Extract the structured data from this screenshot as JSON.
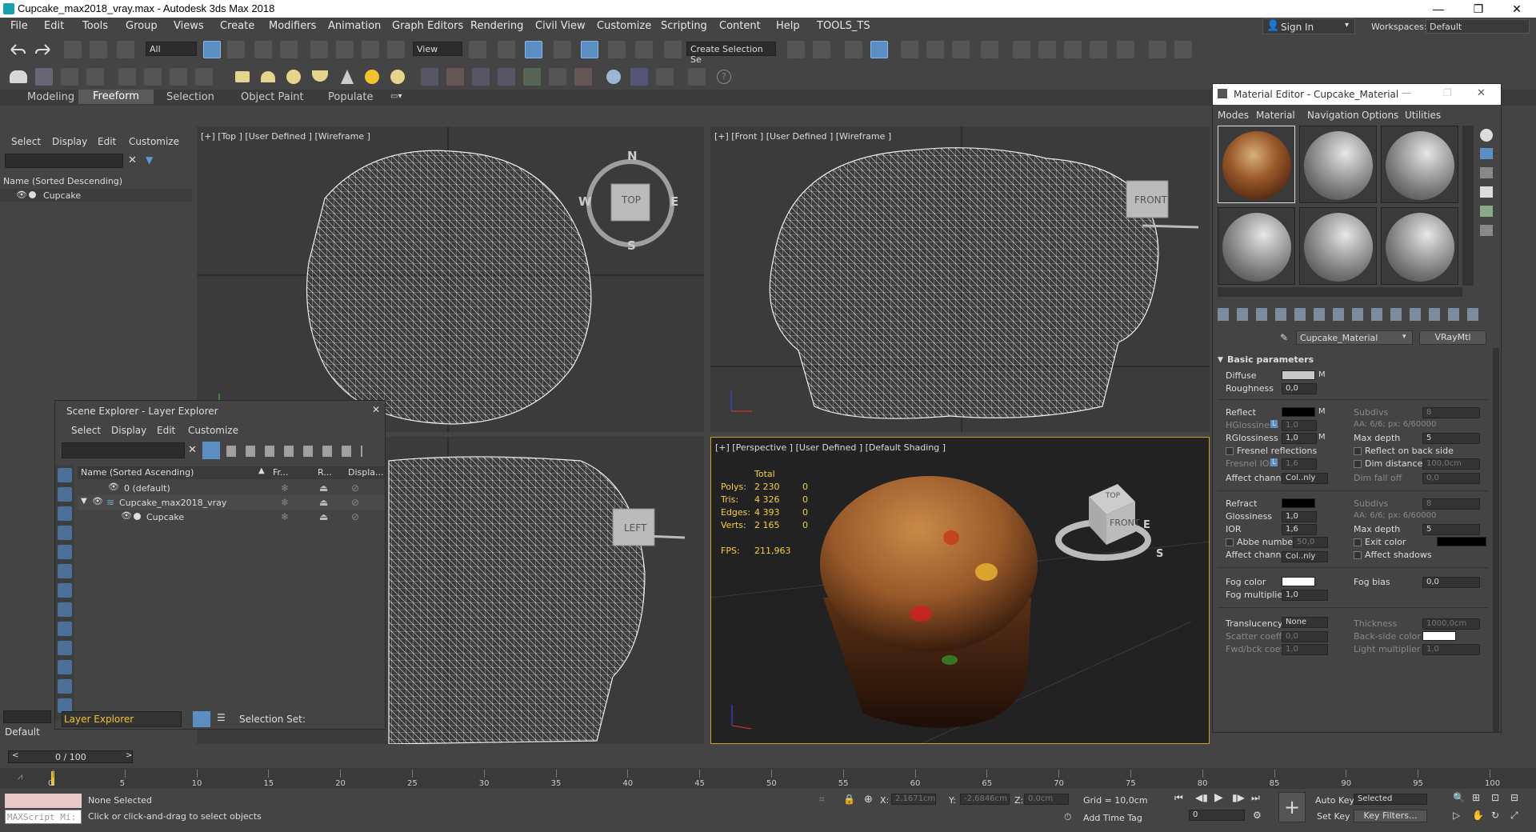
{
  "window": {
    "title": "Cupcake_max2018_vray.max - Autodesk 3ds Max 2018",
    "min": "—",
    "max": "❐",
    "close": "✕"
  },
  "menu": [
    "File",
    "Edit",
    "Tools",
    "Group",
    "Views",
    "Create",
    "Modifiers",
    "Animation",
    "Graph Editors",
    "Rendering",
    "Civil View",
    "Customize",
    "Scripting",
    "Content",
    "Help",
    "TOOLS_TS"
  ],
  "signin": {
    "label": "Sign In",
    "workspaces_label": "Workspaces:",
    "workspace": "Default"
  },
  "toolbar": {
    "filter": "All",
    "refcoord": "View",
    "selection_set": "Create Selection Se"
  },
  "ribbon": {
    "tabs": [
      "Modeling",
      "Freeform",
      "Selection",
      "Object Paint",
      "Populate"
    ],
    "active": "Freeform"
  },
  "left_panel": {
    "tabs": [
      "Select",
      "Display",
      "Edit",
      "Customize"
    ],
    "column": "Name (Sorted Descending)",
    "item": "Cupcake",
    "bottom_dropdown": "Layer Explorer",
    "selection_set_label": "Selection Set:",
    "bottom_label": "Default"
  },
  "viewports": {
    "top": {
      "label": "[+] [Top ] [User Defined ] [Wireframe ]",
      "cube": "TOP",
      "n": "N",
      "s": "S",
      "e": "E",
      "w": "W"
    },
    "front": {
      "label": "[+] [Front ] [User Defined ] [Wireframe ]",
      "cube": "FRONT"
    },
    "left": {
      "cube": "LEFT"
    },
    "persp": {
      "label": "[+] [Perspective ] [User Defined ] [Default Shading ]",
      "cube_top": "TOP",
      "cube_front": "FRONT",
      "s": "S",
      "e": "E"
    },
    "stats": {
      "total": "Total",
      "polys_label": "Polys:",
      "polys": "2 230",
      "polys_sel": "0",
      "tris_label": "Tris:",
      "tris": "4 326",
      "tris_sel": "0",
      "edges_label": "Edges:",
      "edges": "4 393",
      "edges_sel": "0",
      "verts_label": "Verts:",
      "verts": "2 165",
      "verts_sel": "0",
      "fps_label": "FPS:",
      "fps": "211,963"
    }
  },
  "scene_explorer": {
    "title": "Scene Explorer - Layer Explorer",
    "close": "✕",
    "menu": [
      "Select",
      "Display",
      "Edit",
      "Customize"
    ],
    "columns": [
      "Name (Sorted Ascending)",
      "Fr...",
      "R...",
      "Displa..."
    ],
    "rows": [
      {
        "name": "0 (default)"
      },
      {
        "name": "Cupcake_max2018_vray"
      },
      {
        "name": "Cupcake"
      }
    ]
  },
  "material_editor": {
    "title": "Material Editor - Cupcake_Material",
    "menu": [
      "Modes",
      "Material",
      "Navigation",
      "Options",
      "Utilities"
    ],
    "material_name": "Cupcake_Material",
    "material_type": "VRayMtl",
    "rollout": "Basic parameters",
    "diffuse": "Diffuse",
    "m": "M",
    "roughness_label": "Roughness",
    "roughness": "0,0",
    "reflect": "Reflect",
    "subdivs_label": "Subdivs",
    "subdivs": "8",
    "hglossiness_label": "HGlossiness",
    "l": "L",
    "hglossiness": "1,0",
    "aa_info": "AA: 6/6; px: 6/60000",
    "rglossiness_label": "RGlossiness",
    "rglossiness": "1,0",
    "max_depth_label": "Max depth",
    "max_depth": "5",
    "fresnel": "Fresnel reflections",
    "reflect_back": "Reflect on back side",
    "fresnel_ior_label": "Fresnel IOR",
    "fresnel_ior": "1,6",
    "dim_distance_label": "Dim distance",
    "dim_distance": "100,0cm",
    "affect_channels_label": "Affect channels",
    "affect_channels": "Col..nly",
    "dim_falloff_label": "Dim fall off",
    "dim_falloff": "0,0",
    "refract": "Refract",
    "r_subdivs": "8",
    "glossiness_label": "Glossiness",
    "glossiness": "1,0",
    "ior_label": "IOR",
    "ior": "1,6",
    "r_max_depth": "5",
    "abbe_label": "Abbe number",
    "abbe": "50,0",
    "exit_color": "Exit color",
    "affect_shadows": "Affect shadows",
    "fog_color_label": "Fog color",
    "fog_bias_label": "Fog bias",
    "fog_bias": "0,0",
    "fog_mult_label": "Fog multiplier",
    "fog_mult": "1,0",
    "translucency_label": "Translucency",
    "translucency": "None",
    "thickness_label": "Thickness",
    "thickness": "1000,0cm",
    "scatter_label": "Scatter coeff",
    "scatter": "0,0",
    "backside_label": "Back-side color",
    "fwdbck_label": "Fwd/bck coeff",
    "fwdbck": "1,0",
    "light_mult_label": "Light multiplier",
    "light_mult": "1,0"
  },
  "timeline": {
    "frame": "0 / 100",
    "ticks": [
      "0",
      "5",
      "10",
      "15",
      "20",
      "25",
      "30",
      "35",
      "40",
      "45",
      "50",
      "55",
      "60",
      "65",
      "70",
      "75",
      "80",
      "85",
      "90",
      "95",
      "100"
    ]
  },
  "status": {
    "maxscript": "MAXScript Mi:",
    "selected": "None Selected",
    "prompt": "Click or click-and-drag to select objects",
    "x_label": "X:",
    "x": "2,1671cm",
    "y_label": "Y:",
    "y": "-2,6846cm",
    "z_label": "Z:",
    "z": "0,0cm",
    "grid": "Grid = 10,0cm",
    "add_time_tag": "Add Time Tag",
    "auto_key": "Auto Key",
    "set_key": "Set Key",
    "key_mode": "Selected",
    "key_filters": "Key Filters...",
    "frame": "0"
  }
}
